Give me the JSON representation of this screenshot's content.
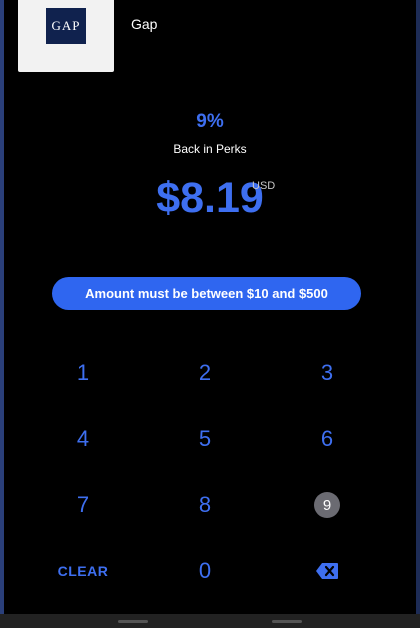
{
  "merchant": {
    "logo_text": "GAP",
    "name": "Gap"
  },
  "perks": {
    "percent": "9%",
    "label": "Back in Perks"
  },
  "amount": {
    "value": "$8.19",
    "currency": "USD"
  },
  "validation": {
    "message": "Amount must be between $10 and $500"
  },
  "keypad": {
    "keys": [
      "1",
      "2",
      "3",
      "4",
      "5",
      "6",
      "7",
      "8",
      "9",
      "CLEAR",
      "0"
    ],
    "backspace_icon": "backspace-icon"
  },
  "colors": {
    "accent": "#3e6ff0",
    "pill": "#2f66f0",
    "background": "#000000"
  }
}
